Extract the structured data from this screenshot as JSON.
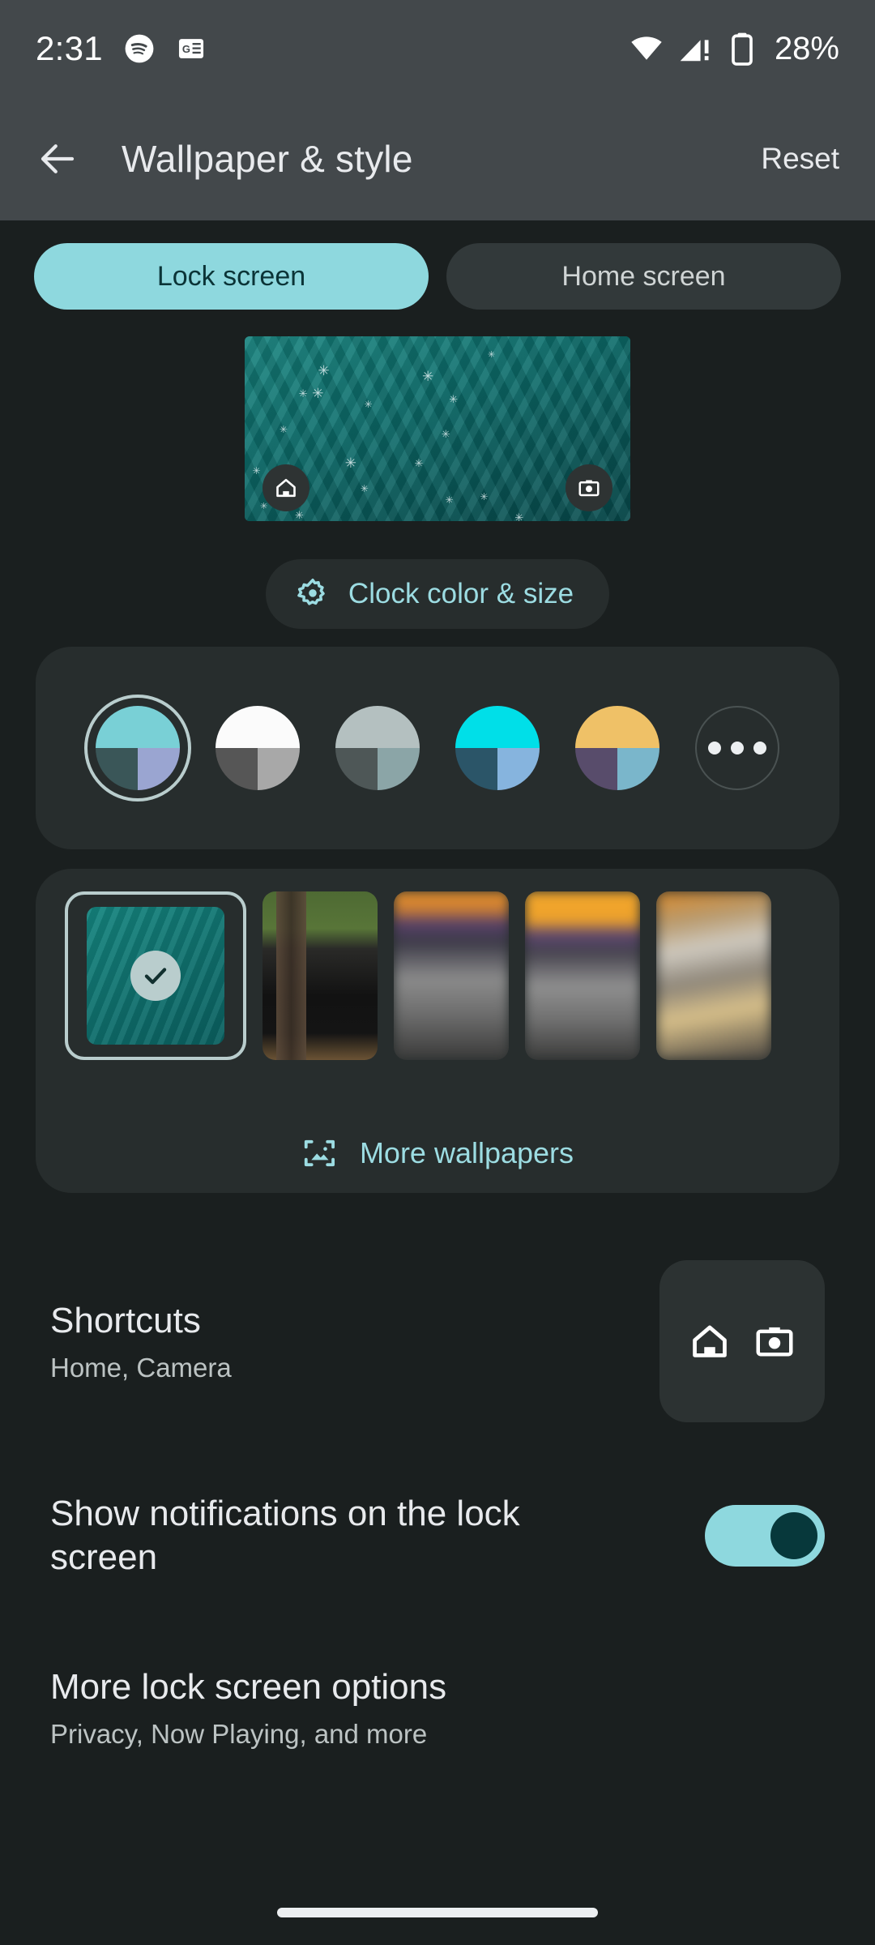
{
  "status_bar": {
    "time": "2:31",
    "battery_percent": "28%",
    "icons": [
      "spotify-icon",
      "google-news-icon",
      "wifi-icon",
      "cellular-signal-warning-icon",
      "battery-icon"
    ]
  },
  "app_bar": {
    "back": "back-arrow-icon",
    "title": "Wallpaper & style",
    "action_label": "Reset"
  },
  "tabs": [
    {
      "label": "Lock screen",
      "active": true
    },
    {
      "label": "Home screen",
      "active": false
    }
  ],
  "preview": {
    "home_shortcut": "home-icon",
    "camera_shortcut": "camera-icon"
  },
  "clock_chip": {
    "label": "Clock color & size",
    "icon": "gear-icon"
  },
  "colors": {
    "swatches": [
      {
        "name": "teal",
        "selected": true,
        "top": "#79d0d6",
        "bottom_left": "#3a5658",
        "bottom_right": "#9aa5d1"
      },
      {
        "name": "white",
        "selected": false,
        "top": "#fbfbfb",
        "bottom_left": "#565656",
        "bottom_right": "#a8a8a8"
      },
      {
        "name": "gray",
        "selected": false,
        "top": "#b4c0c0",
        "bottom_left": "#4e5757",
        "bottom_right": "#8ba5a7"
      },
      {
        "name": "cyan",
        "selected": false,
        "top": "#00dfe8",
        "bottom_left": "#2b5568",
        "bottom_right": "#86b4de"
      },
      {
        "name": "amber",
        "selected": false,
        "top": "#efc167",
        "bottom_left": "#584c6b",
        "bottom_right": "#7ab6cb"
      }
    ],
    "more_label": "more-colors-icon"
  },
  "wallpapers": {
    "thumbs": [
      {
        "name": "teal-leaves-wallpaper",
        "selected": true
      },
      {
        "name": "black-car-wallpaper",
        "selected": false
      },
      {
        "name": "blurred-sunset-wallpaper-1",
        "selected": false
      },
      {
        "name": "blurred-sunset-wallpaper-2",
        "selected": false
      },
      {
        "name": "blurred-sunset-wallpaper-3",
        "selected": false
      }
    ],
    "more_label": "More wallpapers",
    "more_icon": "image-frame-icon"
  },
  "rows": {
    "shortcuts": {
      "title": "Shortcuts",
      "subtitle": "Home, Camera",
      "icons": [
        "home-icon",
        "camera-icon"
      ]
    },
    "notifications": {
      "title": "Show notifications on the lock screen",
      "toggle_on": true
    },
    "more_options": {
      "title": "More lock screen options",
      "subtitle": "Privacy, Now Playing, and more"
    }
  },
  "theme": {
    "accent": "#8ed8de",
    "accent_text": "#9cdce2",
    "page_bg": "#1a1f1f",
    "card_bg": "#272d2d",
    "bar_bg": "#43484b"
  }
}
